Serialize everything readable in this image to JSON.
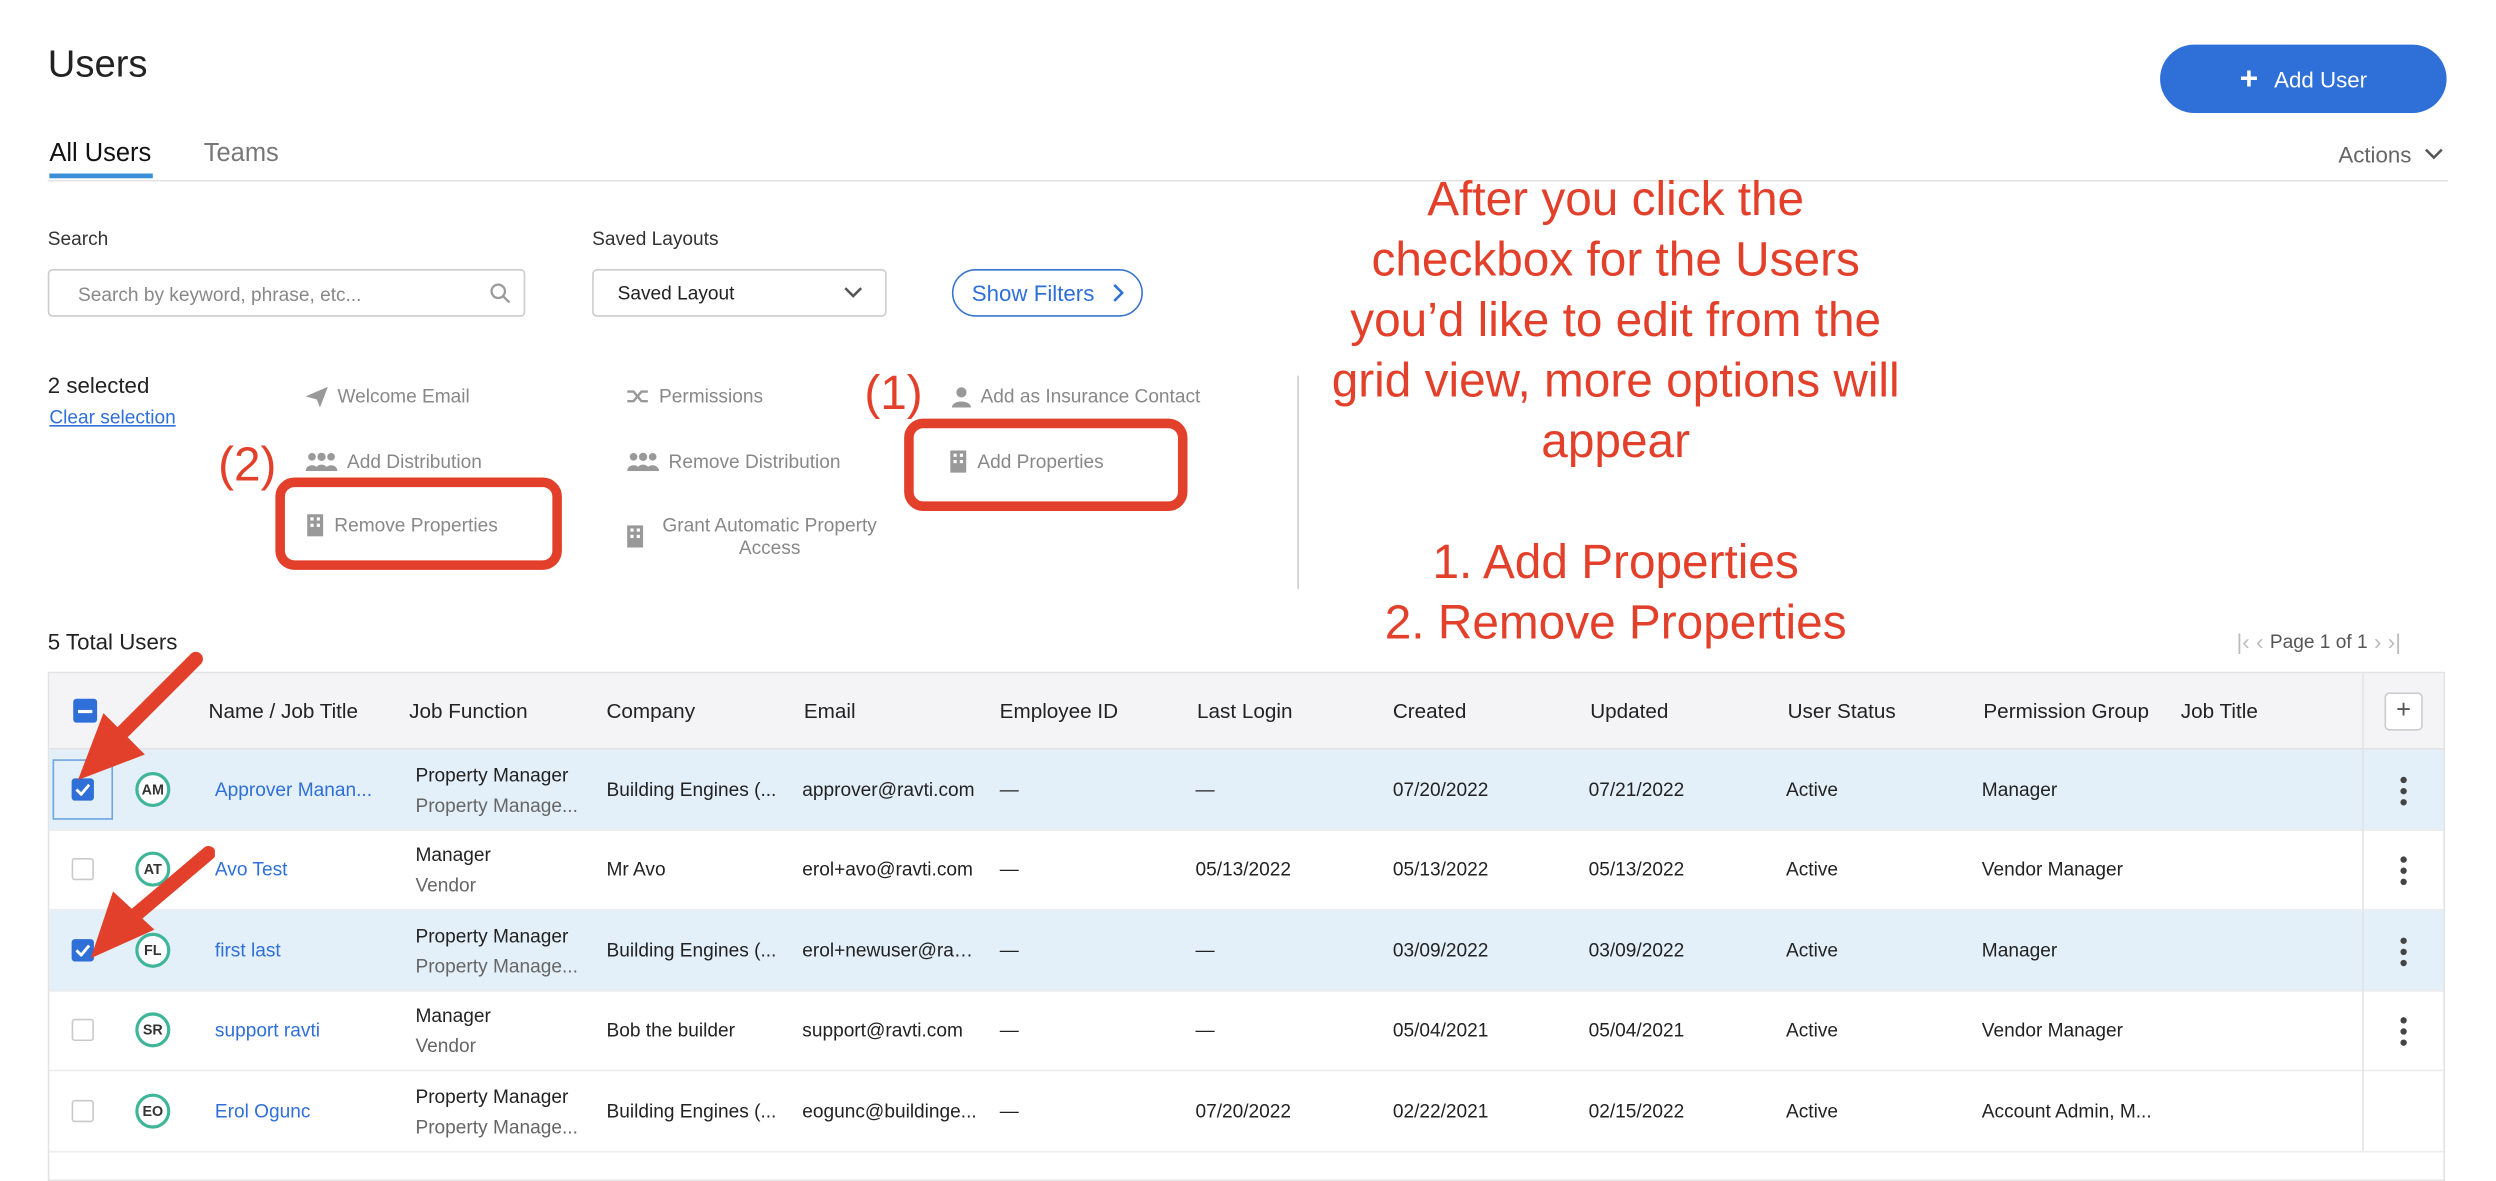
{
  "header": {
    "close_glyph": "‹",
    "title": "Users",
    "add_user_label": "Add User"
  },
  "tabs": [
    {
      "label": "All Users",
      "active": true
    },
    {
      "label": "Teams",
      "active": false
    }
  ],
  "actions_label": "Actions",
  "search": {
    "label": "Search",
    "placeholder": "Search by keyword, phrase, etc..."
  },
  "saved_layouts": {
    "label": "Saved Layouts",
    "value": "Saved Layout"
  },
  "show_filters_label": "Show Filters",
  "selection": {
    "count_text": "2 selected",
    "clear_label": "Clear selection"
  },
  "bulk_actions": {
    "welcome_email": "Welcome Email",
    "permissions": "Permissions",
    "add_insurance_contact": "Add as Insurance Contact",
    "add_distribution": "Add Distribution",
    "remove_distribution": "Remove Distribution",
    "add_properties": "Add Properties",
    "remove_properties": "Remove Properties",
    "grant_auto_access": "Grant Automatic Property Access"
  },
  "annotation": {
    "marker_1": "(1)",
    "marker_2": "(2)",
    "text": "After you click the\ncheckbox for the Users\nyou’d like to edit from the\ngrid view, more options will\nappear\n\n1. Add Properties\n2. Remove Properties",
    "color": "#e2402b"
  },
  "grid": {
    "total_text": "5 Total Users",
    "page_text": "Page 1 of 1",
    "columns": [
      "Name / Job Title",
      "Job Function",
      "Company",
      "Email",
      "Employee ID",
      "Last Login",
      "Created",
      "Updated",
      "User Status",
      "Permission Group",
      "Job Title"
    ],
    "rows": [
      {
        "selected": true,
        "initials": "AM",
        "name": "Approver Manan...",
        "job_function": "Property Manager",
        "job_function_sub": "Property Manage...",
        "company": "Building Engines (...",
        "email": "approver@ravti.com",
        "employee_id": "—",
        "last_login": "—",
        "created": "07/20/2022",
        "updated": "07/21/2022",
        "status": "Active",
        "permission_group": "Manager",
        "job_title": ""
      },
      {
        "selected": false,
        "initials": "AT",
        "name": "Avo Test",
        "job_function": "Manager",
        "job_function_sub": "Vendor",
        "company": "Mr Avo",
        "email": "erol+avo@ravti.com",
        "employee_id": "—",
        "last_login": "05/13/2022",
        "created": "05/13/2022",
        "updated": "05/13/2022",
        "status": "Active",
        "permission_group": "Vendor Manager",
        "job_title": ""
      },
      {
        "selected": true,
        "initials": "FL",
        "name": "first last",
        "job_function": "Property Manager",
        "job_function_sub": "Property Manage...",
        "company": "Building Engines (...",
        "email": "erol+newuser@rav...",
        "employee_id": "—",
        "last_login": "—",
        "created": "03/09/2022",
        "updated": "03/09/2022",
        "status": "Active",
        "permission_group": "Manager",
        "job_title": ""
      },
      {
        "selected": false,
        "initials": "SR",
        "name": "support ravti",
        "job_function": "Manager",
        "job_function_sub": "Vendor",
        "company": "Bob the builder",
        "email": "support@ravti.com",
        "employee_id": "—",
        "last_login": "—",
        "created": "05/04/2021",
        "updated": "05/04/2021",
        "status": "Active",
        "permission_group": "Vendor Manager",
        "job_title": ""
      },
      {
        "selected": false,
        "initials": "EO",
        "name": "Erol Ogunc",
        "job_function": "Property Manager",
        "job_function_sub": "Property Manage...",
        "company": "Building Engines (...",
        "email": "eogunc@buildinge...",
        "employee_id": "—",
        "last_login": "07/20/2022",
        "created": "02/22/2021",
        "updated": "02/15/2022",
        "status": "Active",
        "permission_group": "Account Admin, M...",
        "job_title": ""
      }
    ]
  }
}
